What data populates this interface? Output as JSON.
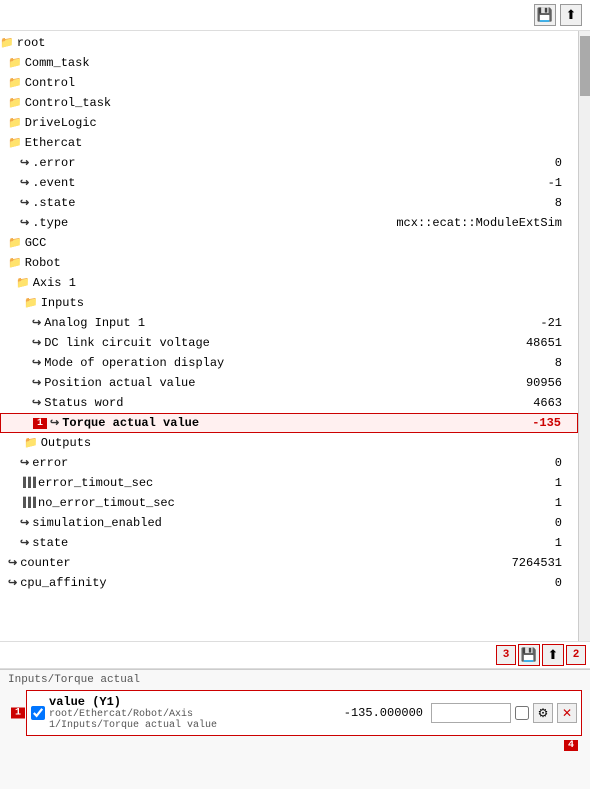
{
  "toolbar": {
    "save_icon": "💾",
    "upload_icon": "⬆"
  },
  "tree": {
    "items": [
      {
        "id": "root",
        "label": "root",
        "indent": 0,
        "type": "folder",
        "value": "",
        "icon": "folder"
      },
      {
        "id": "comm_task",
        "label": "Comm_task",
        "indent": 8,
        "type": "folder",
        "value": "",
        "icon": "folder"
      },
      {
        "id": "control",
        "label": "Control",
        "indent": 8,
        "type": "folder",
        "value": "",
        "icon": "folder"
      },
      {
        "id": "control_task",
        "label": "Control_task",
        "indent": 8,
        "type": "folder",
        "value": "",
        "icon": "folder"
      },
      {
        "id": "drivelogic",
        "label": "DriveLogic",
        "indent": 8,
        "type": "folder",
        "value": "",
        "icon": "folder"
      },
      {
        "id": "ethercat",
        "label": "Ethercat",
        "indent": 8,
        "type": "folder",
        "value": "",
        "icon": "folder"
      },
      {
        "id": "ethercat_error",
        "label": ".error",
        "indent": 20,
        "type": "input",
        "value": "0",
        "icon": "input"
      },
      {
        "id": "ethercat_event",
        "label": ".event",
        "indent": 20,
        "type": "input",
        "value": "-1",
        "icon": "input"
      },
      {
        "id": "ethercat_state",
        "label": ".state",
        "indent": 20,
        "type": "input",
        "value": "8",
        "icon": "input"
      },
      {
        "id": "ethercat_type",
        "label": ".type",
        "indent": 20,
        "type": "input",
        "value": "mcx::ecat::ModuleExtSim",
        "icon": "input"
      },
      {
        "id": "gcc",
        "label": "GCC",
        "indent": 8,
        "type": "folder",
        "value": "",
        "icon": "folder"
      },
      {
        "id": "robot",
        "label": "Robot",
        "indent": 8,
        "type": "folder",
        "value": "",
        "icon": "folder"
      },
      {
        "id": "axis1",
        "label": "Axis 1",
        "indent": 16,
        "type": "folder",
        "value": "",
        "icon": "folder"
      },
      {
        "id": "inputs",
        "label": "Inputs",
        "indent": 24,
        "type": "folder",
        "value": "",
        "icon": "folder"
      },
      {
        "id": "analog_input1",
        "label": "Analog Input 1",
        "indent": 32,
        "type": "input",
        "value": "-21",
        "icon": "input"
      },
      {
        "id": "dc_link",
        "label": "DC link circuit voltage",
        "indent": 32,
        "type": "input",
        "value": "48651",
        "icon": "input"
      },
      {
        "id": "mode_op",
        "label": "Mode of operation display",
        "indent": 32,
        "type": "input",
        "value": "8",
        "icon": "input"
      },
      {
        "id": "pos_actual",
        "label": "Position actual value",
        "indent": 32,
        "type": "input",
        "value": "90956",
        "icon": "input"
      },
      {
        "id": "status_word",
        "label": "Status word",
        "indent": 32,
        "type": "input",
        "value": "4663",
        "icon": "input"
      },
      {
        "id": "torque_actual",
        "label": "Torque actual value",
        "indent": 32,
        "type": "input",
        "value": "-135",
        "icon": "input",
        "highlighted": true,
        "badge": "1"
      },
      {
        "id": "outputs",
        "label": "Outputs",
        "indent": 24,
        "type": "folder",
        "value": "",
        "icon": "folder"
      },
      {
        "id": "error",
        "label": "error",
        "indent": 20,
        "type": "input",
        "value": "0",
        "icon": "input"
      },
      {
        "id": "error_timout",
        "label": "error_timout_sec",
        "indent": 20,
        "type": "bar",
        "value": "1",
        "icon": "bar"
      },
      {
        "id": "no_error_timout",
        "label": "no_error_timout_sec",
        "indent": 20,
        "type": "bar",
        "value": "1",
        "icon": "bar"
      },
      {
        "id": "sim_enabled",
        "label": "simulation_enabled",
        "indent": 20,
        "type": "input",
        "value": "0",
        "icon": "input"
      },
      {
        "id": "state",
        "label": "state",
        "indent": 20,
        "type": "input",
        "value": "1",
        "icon": "input"
      },
      {
        "id": "counter",
        "label": "counter",
        "indent": 8,
        "type": "input",
        "value": "7264531",
        "icon": "input"
      },
      {
        "id": "cpu_affinity",
        "label": "cpu_affinity",
        "indent": 8,
        "type": "input",
        "value": "0",
        "icon": "bar"
      }
    ]
  },
  "bottom_toolbar": {
    "badge3": "3",
    "save_icon": "💾",
    "upload_icon": "⬆",
    "badge2": "2"
  },
  "var_panel": {
    "title": "Inputs/Torque actual",
    "badge1": "1",
    "badge4": "4",
    "var_name": "value (Y1)",
    "var_path1": "root/Ethercat/Robot/Axis",
    "var_path2": "1/Inputs/Torque actual value",
    "var_value": "-135.000000",
    "var_placeholder": "",
    "gear_icon": "⚙",
    "close_icon": "✕"
  }
}
